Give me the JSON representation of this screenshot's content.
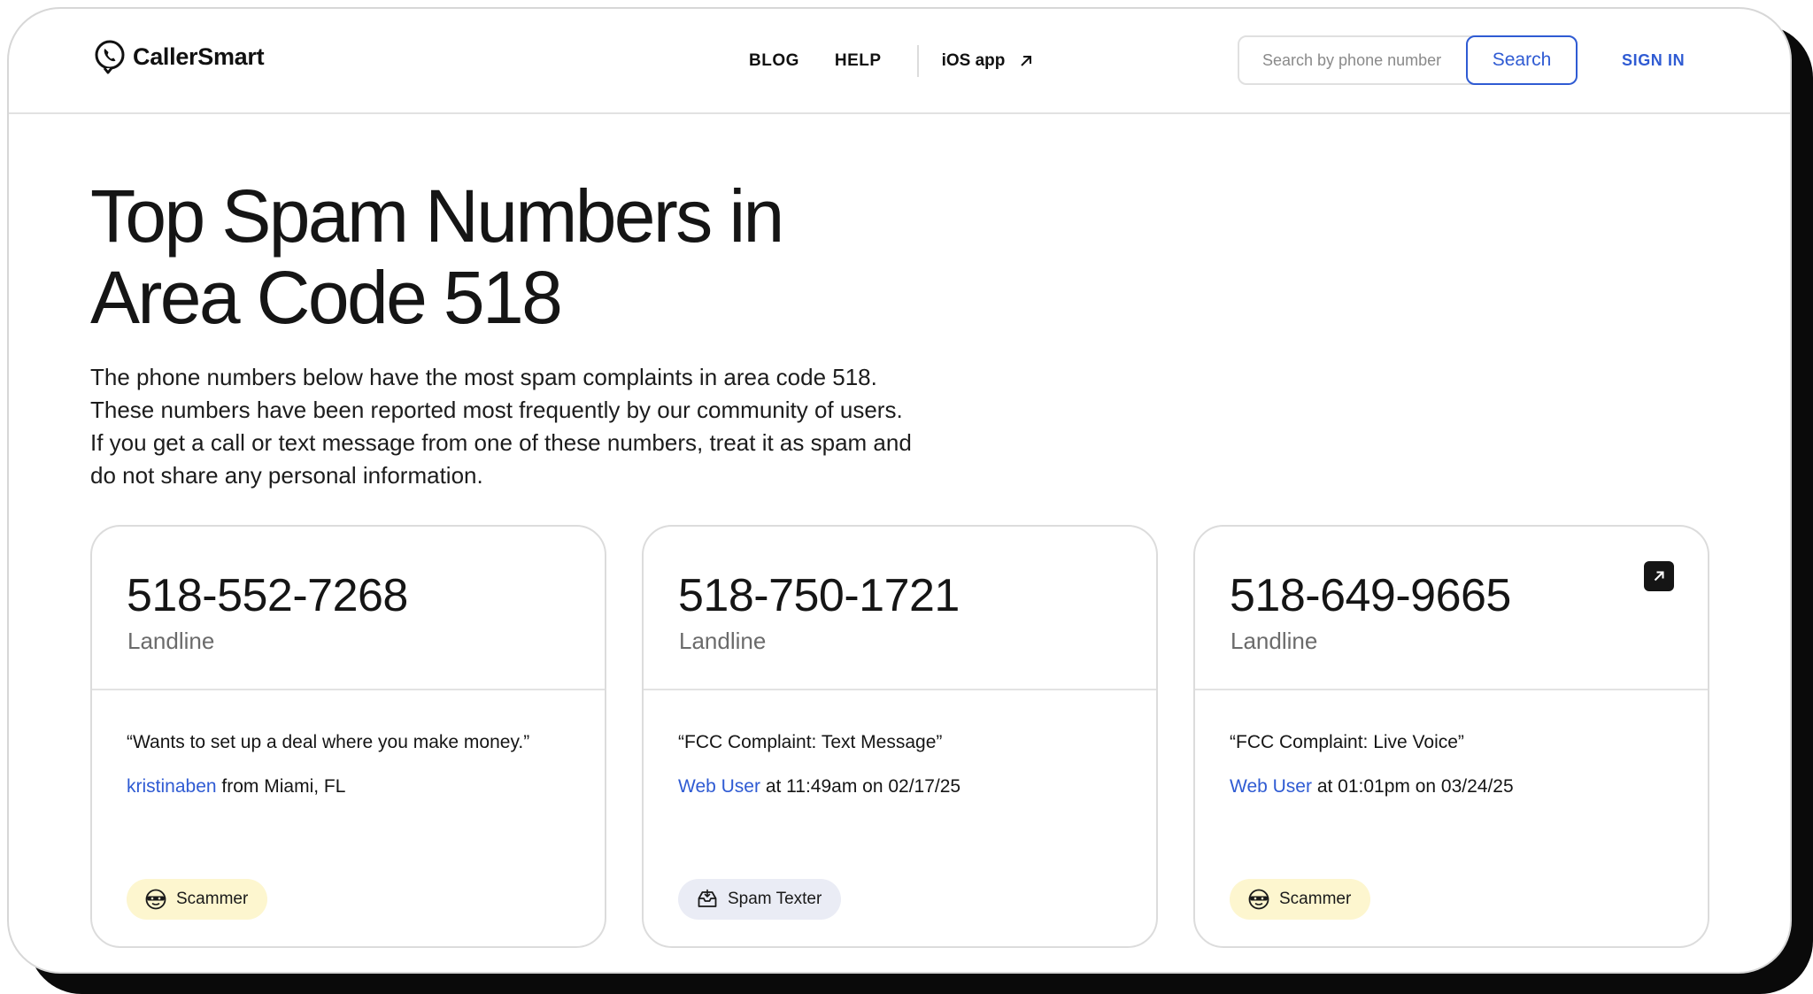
{
  "header": {
    "brand": "CallerSmart",
    "nav": {
      "blog": "BLOG",
      "help": "HELP",
      "ios": "iOS app"
    },
    "search": {
      "placeholder": "Search by phone number",
      "button": "Search"
    },
    "signin": "SIGN IN"
  },
  "hero": {
    "title_line1": "Top Spam Numbers in",
    "title_line2": "Area Code 518",
    "description": "The phone numbers below have the most spam complaints in area code 518. These numbers have been reported most frequently by our community of users. If you get a call or text message from one of these numbers, treat it as spam and do not share any personal information."
  },
  "cards": [
    {
      "number": "518-552-7268",
      "type": "Landline",
      "quote": "“Wants to set up a deal where you make money.”",
      "author": "kristinaben",
      "meta": " from Miami, FL",
      "badge": "Scammer",
      "badge_icon": "scammer-mask-icon"
    },
    {
      "number": "518-750-1721",
      "type": "Landline",
      "quote": "“FCC Complaint: Text Message”",
      "author": "Web User",
      "meta": " at 11:49am on 02/17/25",
      "badge": "Spam Texter",
      "badge_icon": "spam-inbox-icon"
    },
    {
      "number": "518-649-9665",
      "type": "Landline",
      "quote": "“FCC Complaint: Live Voice”",
      "author": "Web User",
      "meta": " at 01:01pm on 03/24/25",
      "badge": "Scammer",
      "badge_icon": "scammer-mask-icon"
    }
  ],
  "colors": {
    "link_blue": "#2f5bd3",
    "scammer_badge_bg": "#fdf6cf",
    "spam_badge_bg": "#eaecf5"
  }
}
